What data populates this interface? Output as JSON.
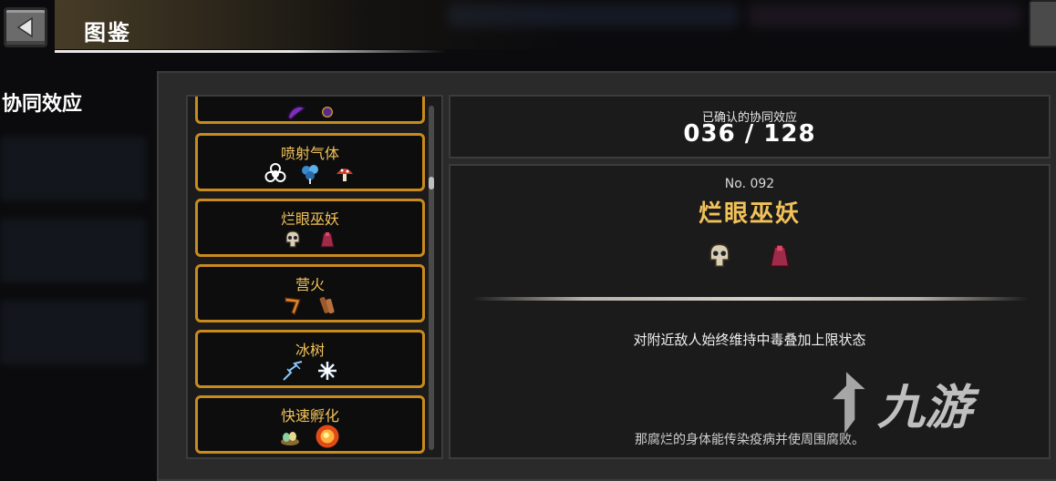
{
  "header": {
    "title": "图鉴"
  },
  "sidebar": {
    "section_label": "协同效应"
  },
  "synergy_list": [
    {
      "name": "",
      "icons": [
        "purple-slug-icon",
        "purple-orb-icon"
      ]
    },
    {
      "name": "喷射气体",
      "icons": [
        "biohazard-icon",
        "blue-mushroom-cluster-icon",
        "red-mushroom-icon"
      ]
    },
    {
      "name": "烂眼巫妖",
      "icons": [
        "skull-icon",
        "red-cloak-icon"
      ]
    },
    {
      "name": "营火",
      "icons": [
        "boomerang-icon",
        "firewood-icon"
      ]
    },
    {
      "name": "冰树",
      "icons": [
        "lightning-branch-icon",
        "snowflake-icon"
      ]
    },
    {
      "name": "快速孵化",
      "icons": [
        "eggs-nest-icon",
        "fire-orb-icon"
      ]
    }
  ],
  "counter": {
    "label": "已确认的协同效应",
    "value": "036 / 128"
  },
  "detail": {
    "number": "No. 092",
    "name": "烂眼巫妖",
    "icons": [
      "skull-icon",
      "red-cloak-icon"
    ],
    "effect": "对附近敌人始终维持中毒叠加上限状态",
    "lore": "那腐烂的身体能传染疫病并使周围腐败。"
  },
  "watermark": {
    "text": "九游"
  },
  "colors": {
    "card_border": "#c98a1e",
    "card_title": "#f2c25a",
    "panel_bg": "#2a2a2a",
    "box_bg": "#1b1b1b"
  }
}
